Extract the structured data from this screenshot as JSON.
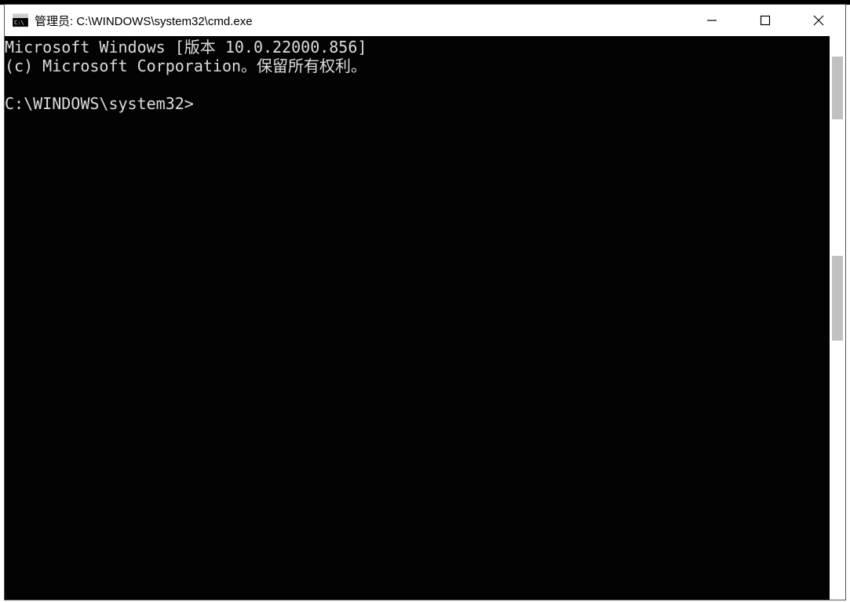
{
  "window": {
    "title": "管理员: C:\\WINDOWS\\system32\\cmd.exe"
  },
  "terminal": {
    "line1": "Microsoft Windows [版本 10.0.22000.856]",
    "line2": "(c) Microsoft Corporation。保留所有权利。",
    "blank": "",
    "prompt": "C:\\WINDOWS\\system32>"
  }
}
